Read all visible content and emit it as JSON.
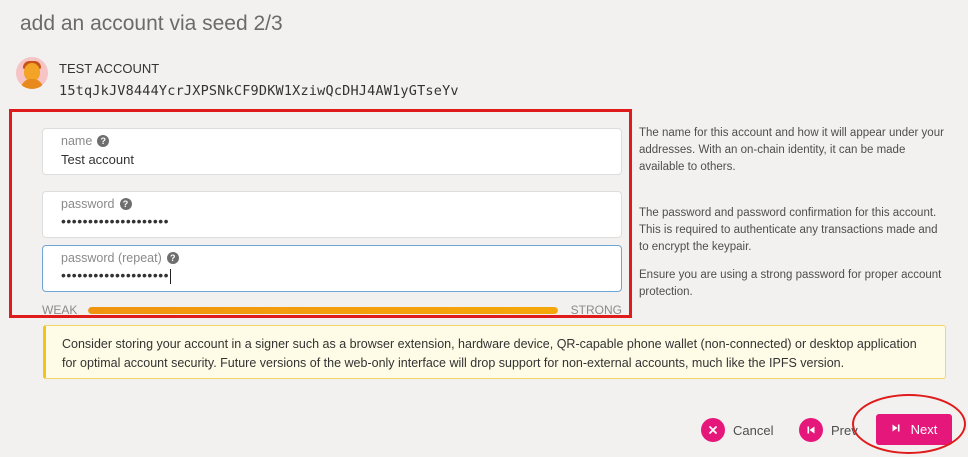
{
  "page": {
    "title": "add an account via seed 2/3"
  },
  "account": {
    "name": "TEST ACCOUNT",
    "address": "15tqJkJV8444YcrJXPSNkCF9DKW1XziwQcDHJ4AW1yGTseYv"
  },
  "form": {
    "name_label": "name",
    "name_value": "Test account",
    "password_label": "password",
    "password_value": "••••••••••••••••••••",
    "password_repeat_label": "password (repeat)",
    "password_repeat_value": "••••••••••••••••••••",
    "help_icon_glyph": "?",
    "strength": {
      "weak_label": "WEAK",
      "strong_label": "STRONG",
      "level_percent": 100
    }
  },
  "help": {
    "name_text": "The name for this account and how it will appear under your addresses. With an on-chain identity, it can be made available to others.",
    "password_text": "The password and password confirmation for this account. This is required to authenticate any transactions made and to encrypt the keypair.",
    "strong_password_text": "Ensure you are using a strong password for proper account protection."
  },
  "warning": {
    "text": "Consider storing your account in a signer such as a browser extension, hardware device, QR-capable phone wallet (non-connected) or desktop application for optimal account security. Future versions of the web-only interface will drop support for non-external accounts, much like the IPFS version."
  },
  "actions": {
    "cancel_label": "Cancel",
    "prev_label": "Prev",
    "next_label": "Next"
  },
  "colors": {
    "accent": "#e6177a",
    "annotation": "#e01b1b",
    "strength_fill": "#f5a70a",
    "warning_border": "#f3c21c"
  },
  "icons": {
    "help": "question-circle-icon",
    "cancel": "x-circle-icon",
    "prev": "step-backward-icon",
    "next": "step-forward-icon"
  }
}
